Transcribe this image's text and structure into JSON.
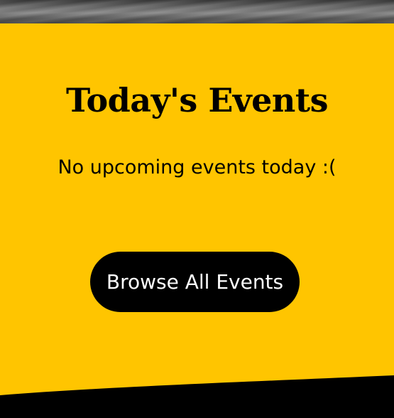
{
  "section": {
    "title": "Today's Events",
    "empty_message": "No upcoming events today :(",
    "browse_button_label": "Browse All Events"
  },
  "colors": {
    "background": "#ffc500",
    "button_background": "#000000",
    "button_text": "#ffffff",
    "text": "#000000",
    "banner": "#6e6e6e",
    "footer_wave": "#000000"
  }
}
